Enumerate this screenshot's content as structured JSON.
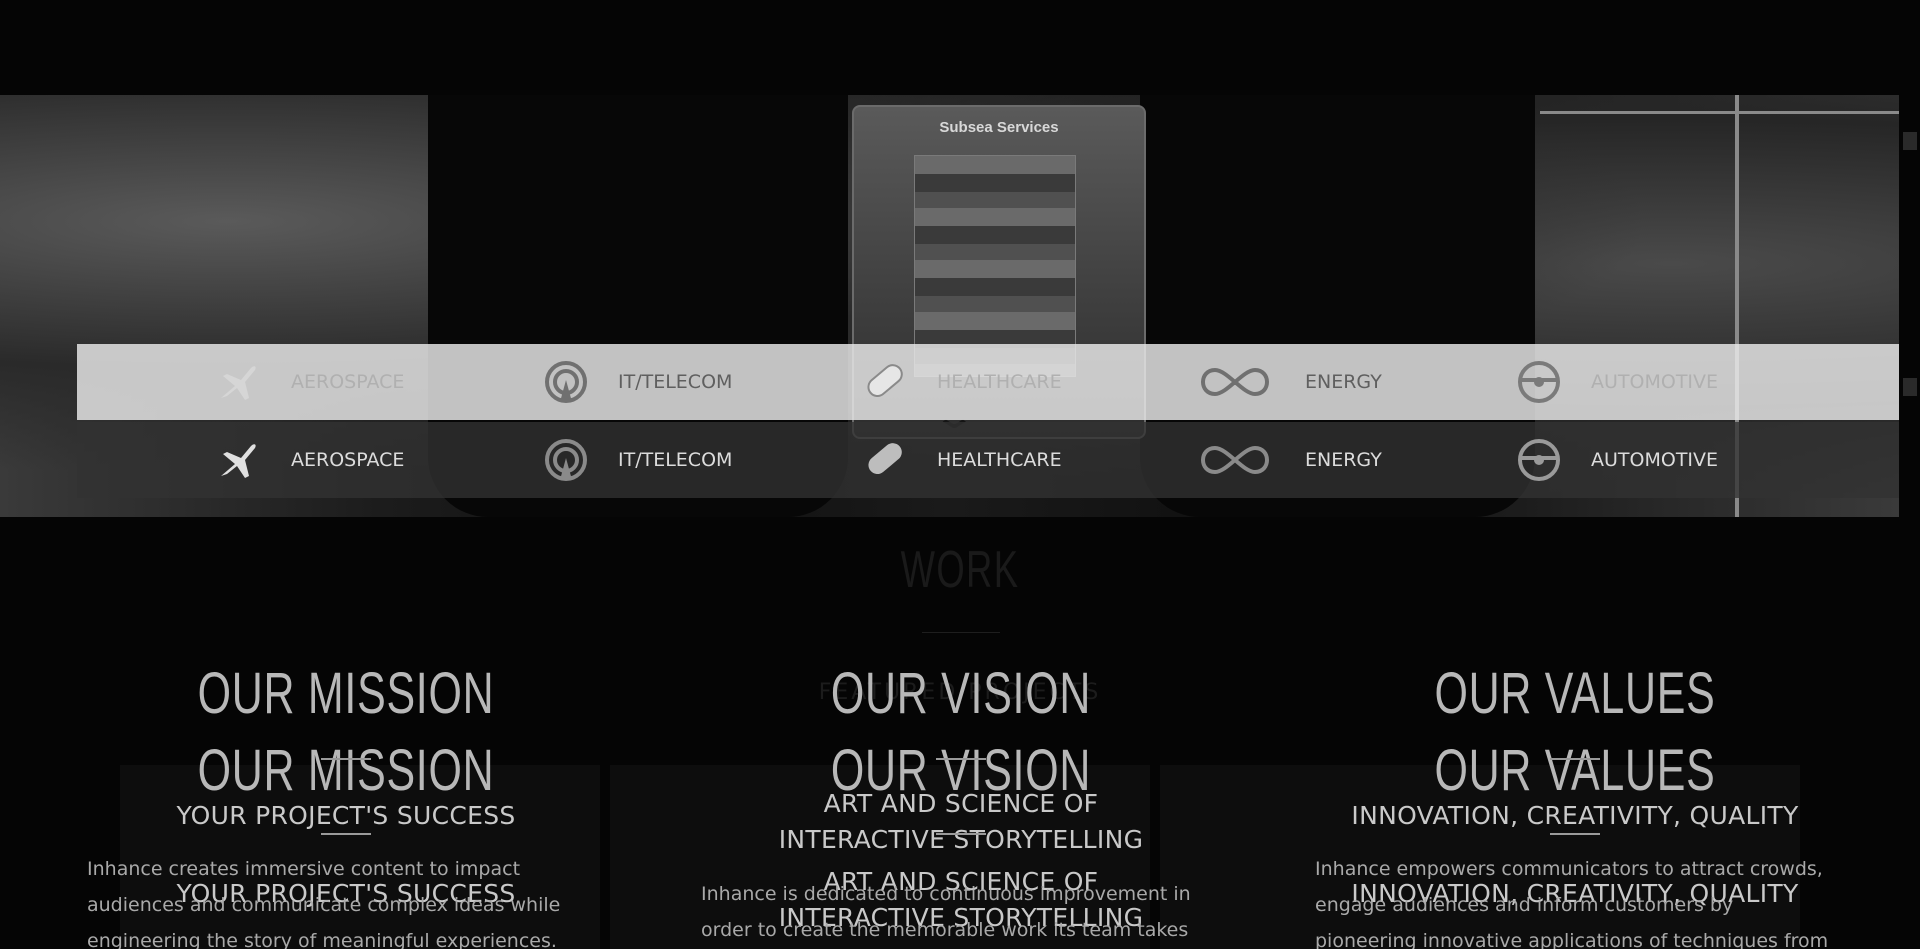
{
  "hero": {
    "panel_title": "Subsea Services"
  },
  "industries": [
    {
      "label": "AEROSPACE",
      "icon": "airplane-icon"
    },
    {
      "label": "IT/TELECOM",
      "icon": "antenna-icon"
    },
    {
      "label": "HEALTHCARE",
      "icon": "pill-icon"
    },
    {
      "label": "ENERGY",
      "icon": "infinity-plug-icon"
    },
    {
      "label": "AUTOMOTIVE",
      "icon": "steering-wheel-icon"
    }
  ],
  "work": {
    "title": "WORK",
    "featured": "FEATURED PROJECTS"
  },
  "columns": {
    "mission": {
      "heading": "OUR MISSION",
      "subheading": "YOUR PROJECT'S SUCCESS",
      "body": "Inhance creates immersive content to impact audiences and communicate complex ideas while engineering the story of meaningful experiences."
    },
    "vision": {
      "heading": "OUR VISION",
      "subheading": "ART AND SCIENCE OF INTERACTIVE STORYTELLING",
      "body": "Inhance is dedicated to continuous improvement in order to create the memorable work its team takes pride in, and"
    },
    "values": {
      "heading": "OUR VALUES",
      "subheading": "INNOVATION, CREATIVITY, QUALITY",
      "body": "Inhance empowers communicators to attract crowds, engage audiences and inform customers by pioneering innovative applications of techniques from the visual"
    }
  },
  "colors": {
    "background": "#050505",
    "band_light": "#ebebeb",
    "band_dark": "#323232",
    "heading": "#b8b8b8"
  }
}
